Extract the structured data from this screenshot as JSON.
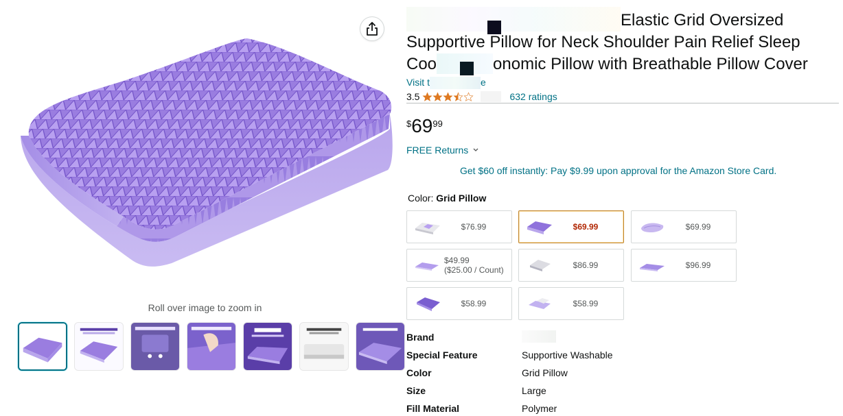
{
  "gallery": {
    "zoom_hint": "Roll over image to zoom in",
    "thumbnail_count": 7,
    "selected_thumbnail": 0,
    "product_color": "#9b7ee0"
  },
  "product": {
    "title": "Elastic Grid Oversized Supportive Pillow for Neck Shoulder Pain Relief Sleep Cool Ergonomic Pillow with Breathable Pillow Cover",
    "title_line1": "Elastic Grid Oversized",
    "title_line2": "Supportive Pillow for Neck Shoulder Pain Relief Sleep",
    "title_line3a": "Coo",
    "title_line3b": "onomic Pillow with Breathable Pillow Cover",
    "store_link_prefix": "Visit t",
    "store_link_suffix": "e",
    "rating_value": "3.5",
    "ratings_count": "632 ratings",
    "price_symbol": "$",
    "price_whole": "69",
    "price_fraction": "99",
    "returns_label": "FREE Returns",
    "promo_text": "Get $60 off instantly: Pay $9.99 upon approval for the Amazon Store Card."
  },
  "color_selector": {
    "label": "Color:",
    "selected_name": "Grid Pillow",
    "options": [
      {
        "price": "$76.99"
      },
      {
        "price": "$69.99"
      },
      {
        "price": "$69.99"
      },
      {
        "price": "$49.99",
        "unit": "($25.00 / Count)"
      },
      {
        "price": "$86.99"
      },
      {
        "price": "$96.99"
      },
      {
        "price": "$58.99"
      },
      {
        "price": "$58.99"
      }
    ],
    "selected_index": 1
  },
  "specs": [
    {
      "key": "Brand",
      "value": ""
    },
    {
      "key": "Special Feature",
      "value": "Supportive Washable"
    },
    {
      "key": "Color",
      "value": "Grid Pillow"
    },
    {
      "key": "Size",
      "value": "Large"
    },
    {
      "key": "Fill Material",
      "value": "Polymer"
    }
  ],
  "colors": {
    "link": "#007185",
    "price_red": "#b12704",
    "star": "#de7921",
    "selected_border": "#c0852f",
    "thumb_selected": "#007185"
  },
  "icons": {
    "share": "share-icon",
    "chevron": "chevron-down-icon",
    "star": "star-icon"
  }
}
